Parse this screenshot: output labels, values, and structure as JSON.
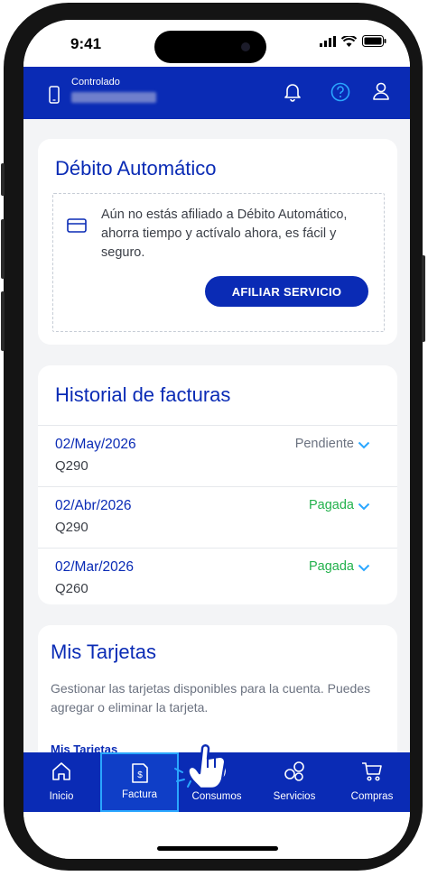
{
  "status_bar": {
    "time": "9:41"
  },
  "header": {
    "subtitle": "Controlado"
  },
  "debito": {
    "title": "Débito Automático",
    "message": "Aún no estás afiliado a Débito Automático, ahorra tiempo y actívalo ahora, es fácil y seguro.",
    "button": "AFILIAR SERVICIO"
  },
  "historial": {
    "title": "Historial de facturas",
    "rows": [
      {
        "date": "02/May/2026",
        "amount": "Q290",
        "status": "Pendiente",
        "status_color": "#6b7280"
      },
      {
        "date": "02/Abr/2026",
        "amount": "Q290",
        "status": "Pagada",
        "status_color": "#22b14c"
      },
      {
        "date": "02/Mar/2026",
        "amount": "Q260",
        "status": "Pagada",
        "status_color": "#22b14c"
      }
    ]
  },
  "tarjetas": {
    "title": "Mis Tarjetas",
    "description": "Gestionar las tarjetas disponibles para la cuenta. Puedes agregar o eliminar la tarjeta.",
    "subheading": "Mis Tarjetas"
  },
  "tabs": [
    {
      "label": "Inicio",
      "icon": "home-icon"
    },
    {
      "label": "Factura",
      "icon": "invoice-icon",
      "active": true
    },
    {
      "label": "Consumos",
      "icon": "usage-icon"
    },
    {
      "label": "Servicios",
      "icon": "services-icon"
    },
    {
      "label": "Compras",
      "icon": "cart-icon"
    }
  ],
  "colors": {
    "brand": "#0a2bb5",
    "accent": "#2aa7ff",
    "paid": "#22b14c"
  }
}
